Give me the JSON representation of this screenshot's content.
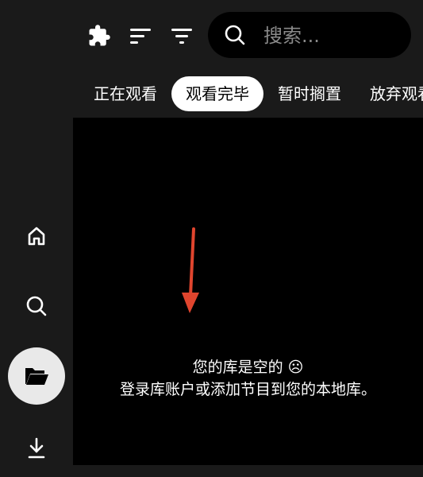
{
  "toolbar": {
    "icons": [
      "extension-icon",
      "sort-icon",
      "filter-icon"
    ]
  },
  "search": {
    "placeholder": "搜索..."
  },
  "tabs": [
    {
      "label": "正在观看",
      "active": false
    },
    {
      "label": "观看完毕",
      "active": true
    },
    {
      "label": "暂时搁置",
      "active": false
    },
    {
      "label": "放弃观看",
      "active": false
    }
  ],
  "sidebar": {
    "items": [
      {
        "name": "home-icon",
        "active": false
      },
      {
        "name": "search-icon",
        "active": false
      },
      {
        "name": "folder-open-icon",
        "active": true
      },
      {
        "name": "download-icon",
        "active": false
      }
    ]
  },
  "empty_state": {
    "line1": "您的库是空的 ☹",
    "line2": "登录库账户或添加节目到您的本地库。"
  },
  "colors": {
    "background": "#1a1a1a",
    "content_bg": "#000000",
    "active_tab_bg": "#ffffff",
    "active_side_bg": "#e9e9e9",
    "annotation_arrow": "#e0452e"
  }
}
